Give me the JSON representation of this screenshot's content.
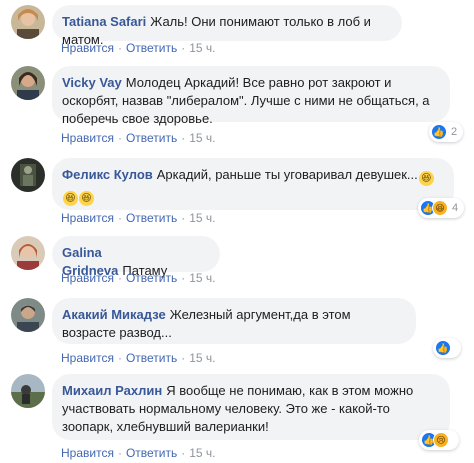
{
  "comments": [
    {
      "author": "Tatiana Safari",
      "text": "Жаль! Они понимают только в лоб и матом.",
      "like": "Нравится",
      "reply": "Ответить",
      "time": "15 ч.",
      "reactions": null
    },
    {
      "author": "Vicky Vay",
      "text": "Молодец Аркадий! Все равно рот закроют и оскорбят, назвав \"либералом\". Лучше с ними не общаться, а поберечь свое здоровье.",
      "like": "Нравится",
      "reply": "Ответить",
      "time": "15 ч.",
      "reactions": {
        "icons": [
          "like-icon"
        ],
        "count": "2"
      }
    },
    {
      "author": "Феликс Кулов",
      "text": "Аркадий, раньше ты уговаривал девушек...",
      "emojis": [
        "laughing-emoji-icon",
        "laughing-emoji-icon",
        "laughing-emoji-icon"
      ],
      "like": "Нравится",
      "reply": "Ответить",
      "time": "15 ч.",
      "reactions": {
        "icons": [
          "like-icon",
          "haha-icon"
        ],
        "count": "4"
      }
    },
    {
      "author": "Galina Gridneva",
      "text": "Патаму",
      "like": "Нравится",
      "reply": "Ответить",
      "time": "15 ч.",
      "reactions": null
    },
    {
      "author": "Акакий Микадзе",
      "text": "Железный аргумент,да в этом возрасте развод...",
      "like": "Нравится",
      "reply": "Ответить",
      "time": "15 ч.",
      "reactions": {
        "icons": [
          "like-icon"
        ],
        "count": ""
      }
    },
    {
      "author": "Михаил Рахлин",
      "text": "Я вообще не понимаю, как в этом можно участвовать нормальному человеку. Это же - какой-то зоопарк, хлебнувший валерианки!",
      "like": "Нравится",
      "reply": "Ответить",
      "time": "15 ч.",
      "reactions": {
        "icons": [
          "like-icon",
          "sad-icon"
        ],
        "count": ""
      }
    }
  ],
  "colors": {
    "author": "#385898",
    "link": "#4267b2",
    "bubble": "#f2f3f5",
    "meta": "#90949c",
    "like_reaction": "#1877f2"
  }
}
